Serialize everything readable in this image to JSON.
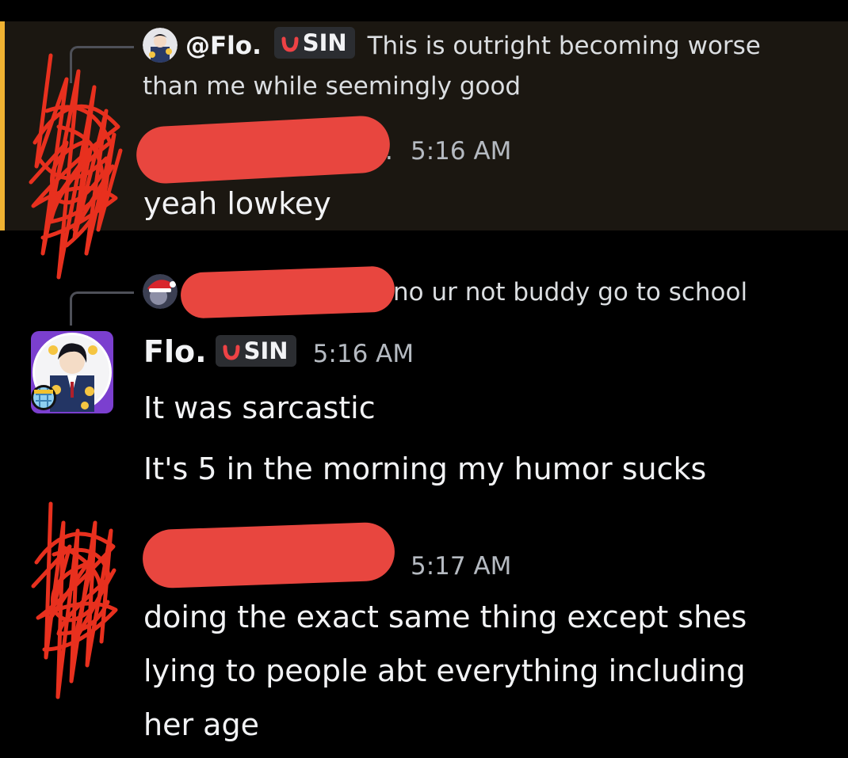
{
  "colors": {
    "background": "#000000",
    "highlight_background": "#1b1711",
    "highlight_accent": "#f0b232",
    "redaction": "#e8463f",
    "tag_icon": "#ed4245"
  },
  "messages": [
    {
      "reply": {
        "author": "@Flo.",
        "tag": "SIN",
        "text_line_1": "This is outright becoming worse",
        "text_line_2": "than me while seemingly good"
      },
      "author": "",
      "timestamp": "5:16 AM",
      "text": "yeah lowkey",
      "highlighted": true
    },
    {
      "reply": {
        "author": "",
        "text": "no ur not buddy go to school"
      },
      "author": "Flo.",
      "tag": "SIN",
      "timestamp": "5:16 AM",
      "lines": [
        "It was sarcastic",
        "It's 5 in the morning my humor sucks"
      ]
    },
    {
      "author": "",
      "timestamp": "5:17 AM",
      "lines": [
        "doing the exact same thing except shes",
        "lying to people abt everything including",
        "her age"
      ]
    }
  ],
  "icons": {
    "tag_icon": "red-horseshoe-icon",
    "reply_avatar_1": "anime-avatar-icon",
    "reply_avatar_2": "santa-hat-avatar-icon"
  }
}
